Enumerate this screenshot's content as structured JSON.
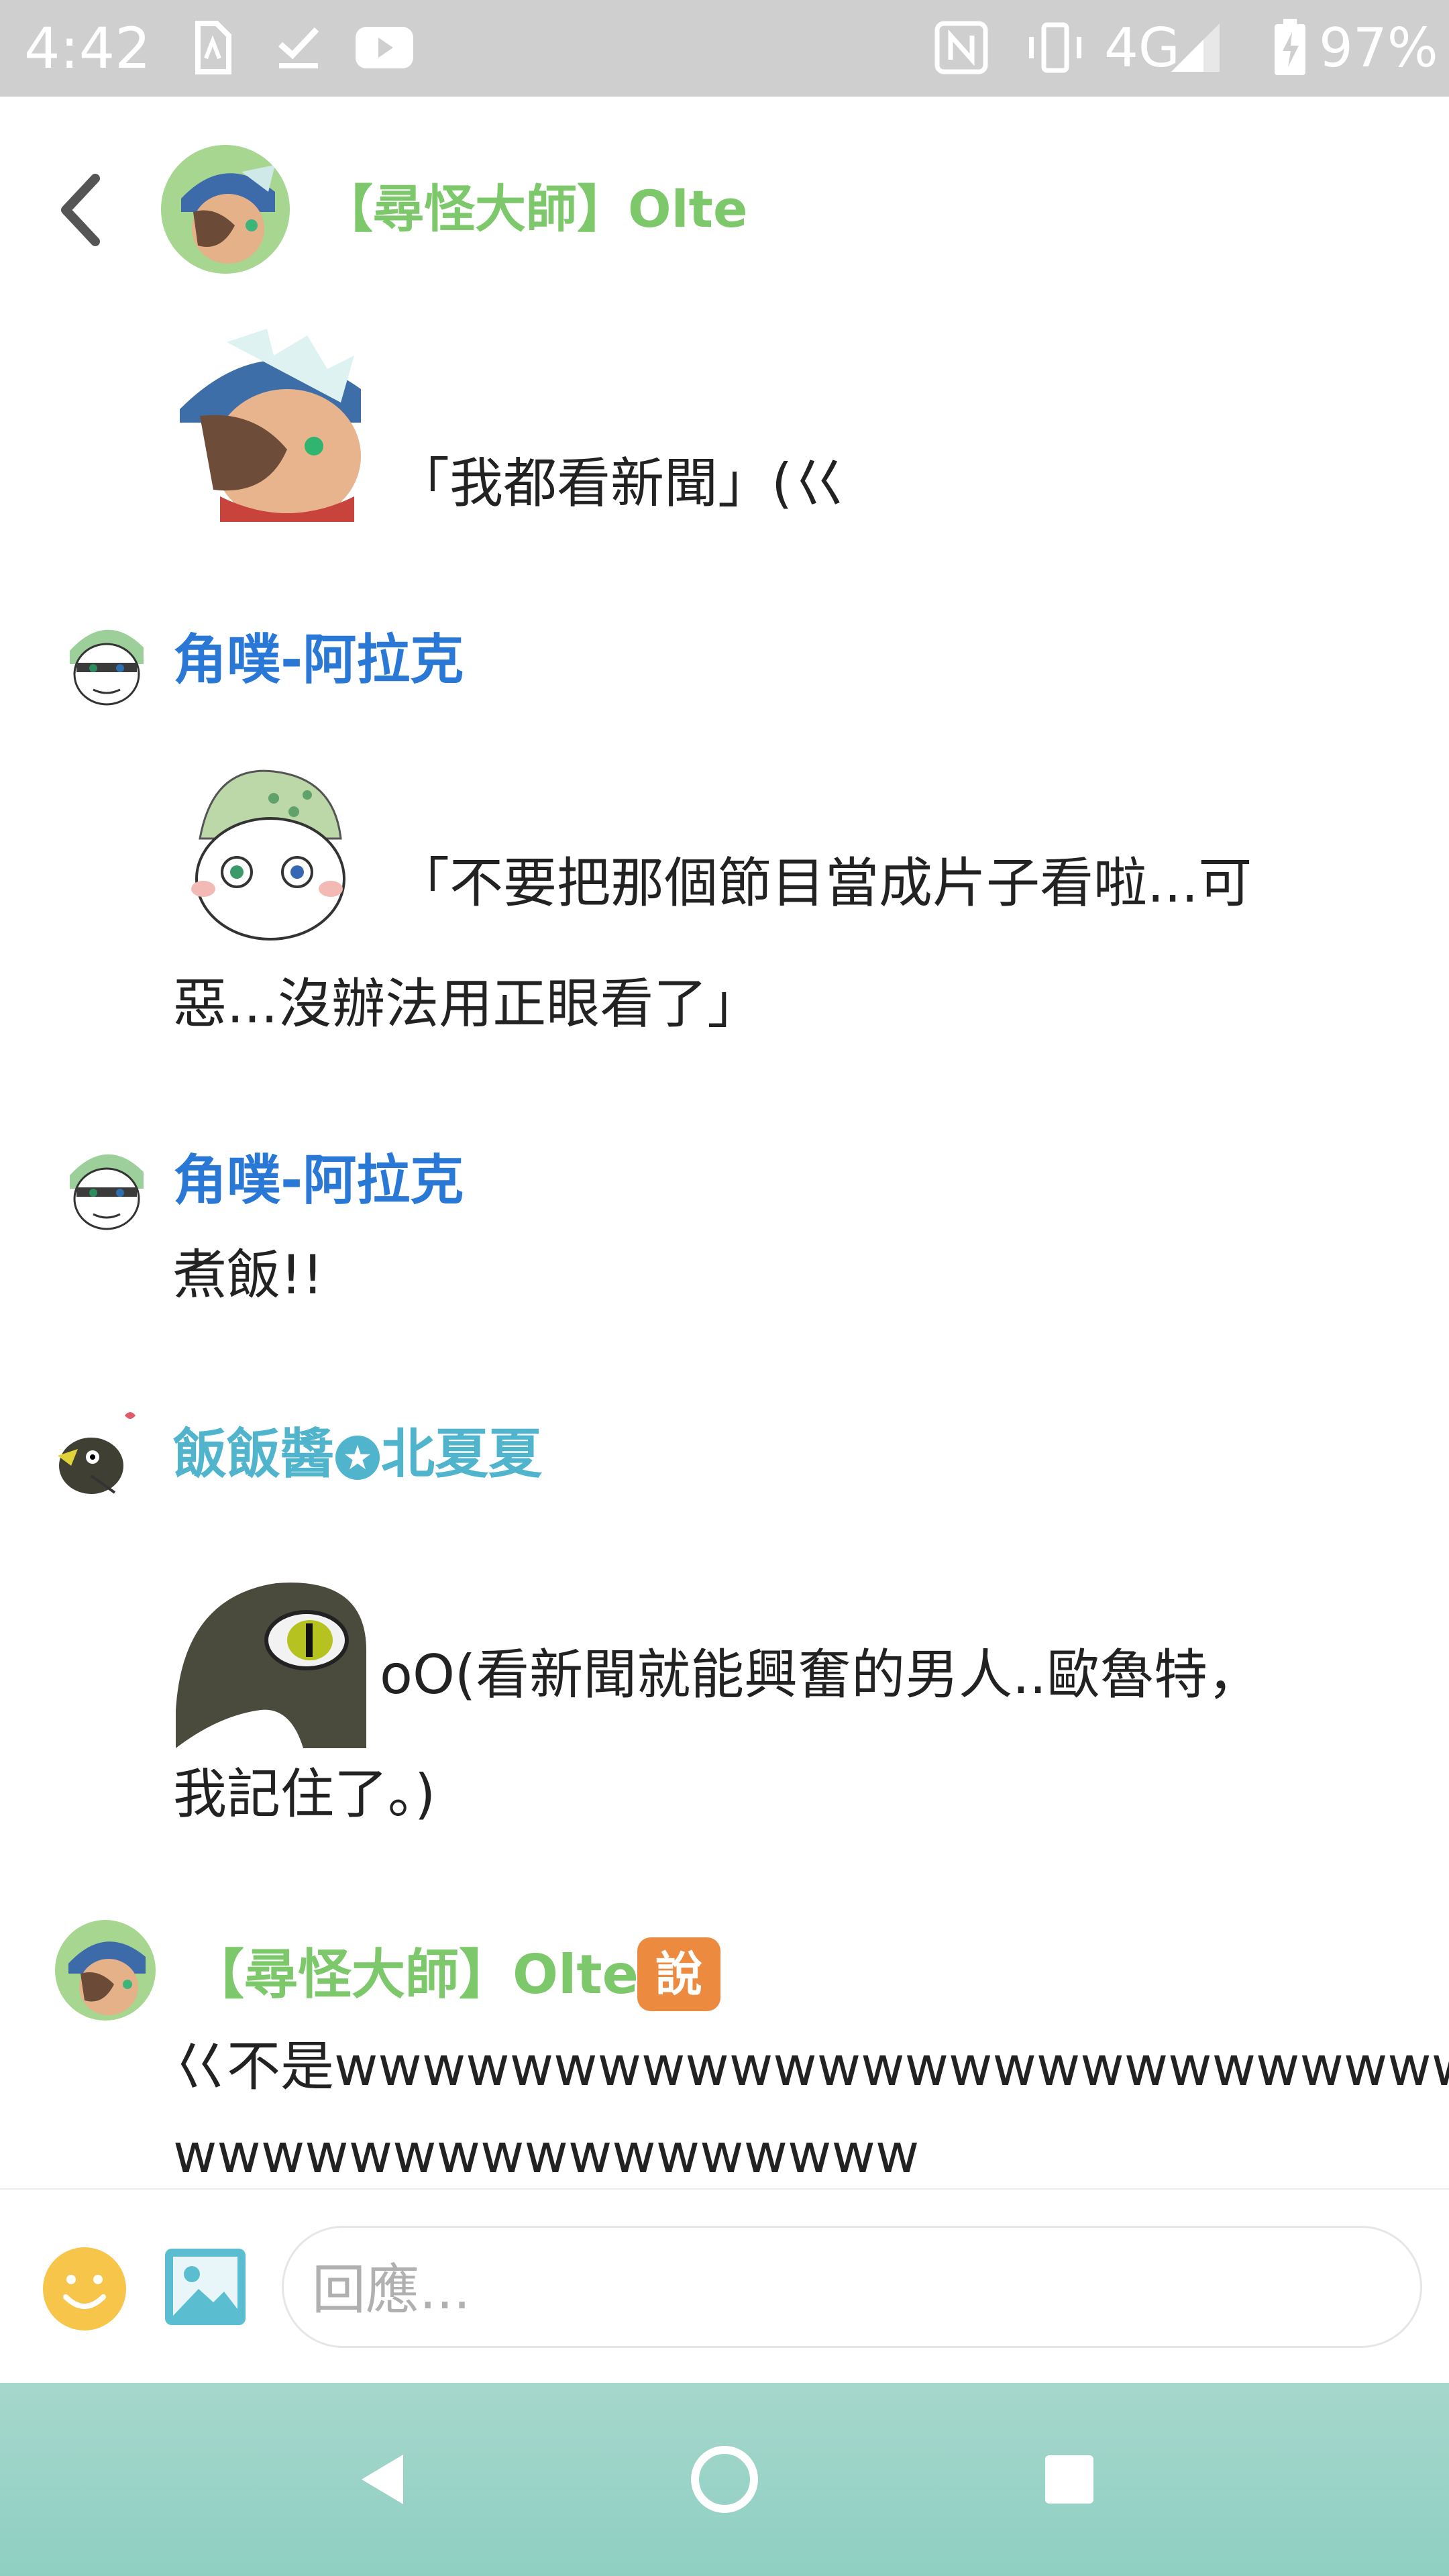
{
  "status_bar": {
    "time": "4:42",
    "network": "4G",
    "battery": "97%",
    "icons": [
      "sim-card-icon",
      "checkmark-download-icon",
      "youtube-icon",
      "nfc-icon",
      "vibrate-icon",
      "signal-icon",
      "battery-charging-icon"
    ]
  },
  "header": {
    "back_icon": "chevron-left-icon",
    "title": "【尋怪大師】Olte"
  },
  "messages": [
    {
      "author": "",
      "sticker": true,
      "text_line1": "「我都看新聞」(巜",
      "text_line2": ""
    },
    {
      "author": "角噗-阿拉克",
      "sticker": true,
      "text_line1": "「不要把那個節目當成片子看啦...可",
      "text_line2": "惡...沒辦法用正眼看了」"
    },
    {
      "author": "角噗-阿拉克",
      "sticker": false,
      "text_line1": "煮飯!!",
      "text_line2": ""
    },
    {
      "author": "飯飯醬",
      "author_suffix": "北夏夏",
      "sticker": true,
      "text_line1": "oO(看新聞就能興奮的男人..歐魯特，",
      "text_line2": "我記住了。)"
    },
    {
      "author": "【尋怪大師】Olte",
      "badge": "說",
      "sticker": false,
      "text_line1": "巜不是wwwwwwwwwwwwwwwwwwwwwwwwwww",
      "text_line2": "wwwwwwwwwwwwwwwww"
    }
  ],
  "composer": {
    "placeholder": "回應...",
    "emoji_icon": "smiley-icon",
    "image_icon": "image-icon"
  },
  "nav": {
    "back_icon": "nav-back-icon",
    "home_icon": "nav-home-icon",
    "recents_icon": "nav-recents-icon"
  },
  "colors": {
    "green_name": "#7cc86a",
    "blue_name": "#2a78d6",
    "cyan_name": "#4fb4cc",
    "badge": "#ec8a3f",
    "emoji": "#f6c54a",
    "image_icon": "#5bbdd0",
    "nav_bar": "#9cd4c8"
  }
}
